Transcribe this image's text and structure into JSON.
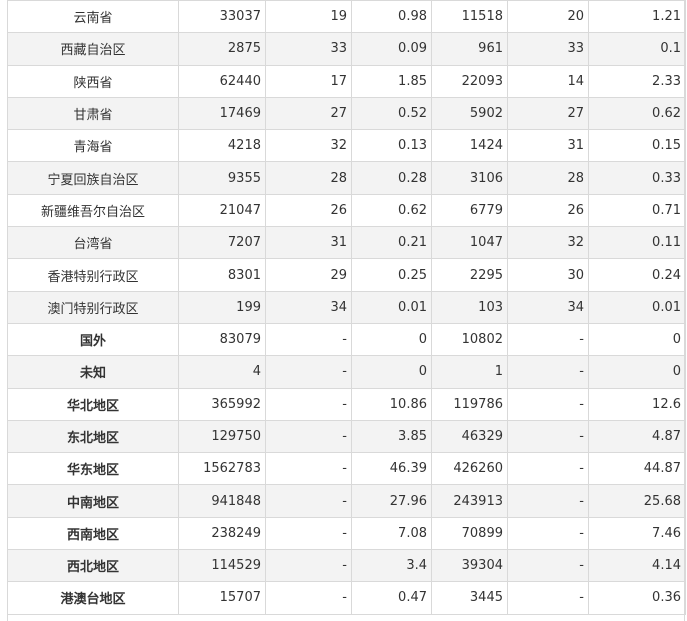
{
  "rows": [
    {
      "name": "云南省",
      "v1": "33037",
      "r1": "19",
      "p1": "0.98",
      "v2": "11518",
      "r2": "20",
      "p2": "1.21",
      "bold": false
    },
    {
      "name": "西藏自治区",
      "v1": "2875",
      "r1": "33",
      "p1": "0.09",
      "v2": "961",
      "r2": "33",
      "p2": "0.1",
      "bold": false
    },
    {
      "name": "陕西省",
      "v1": "62440",
      "r1": "17",
      "p1": "1.85",
      "v2": "22093",
      "r2": "14",
      "p2": "2.33",
      "bold": false
    },
    {
      "name": "甘肃省",
      "v1": "17469",
      "r1": "27",
      "p1": "0.52",
      "v2": "5902",
      "r2": "27",
      "p2": "0.62",
      "bold": false
    },
    {
      "name": "青海省",
      "v1": "4218",
      "r1": "32",
      "p1": "0.13",
      "v2": "1424",
      "r2": "31",
      "p2": "0.15",
      "bold": false
    },
    {
      "name": "宁夏回族自治区",
      "v1": "9355",
      "r1": "28",
      "p1": "0.28",
      "v2": "3106",
      "r2": "28",
      "p2": "0.33",
      "bold": false
    },
    {
      "name": "新疆维吾尔自治区",
      "v1": "21047",
      "r1": "26",
      "p1": "0.62",
      "v2": "6779",
      "r2": "26",
      "p2": "0.71",
      "bold": false
    },
    {
      "name": "台湾省",
      "v1": "7207",
      "r1": "31",
      "p1": "0.21",
      "v2": "1047",
      "r2": "32",
      "p2": "0.11",
      "bold": false
    },
    {
      "name": "香港特别行政区",
      "v1": "8301",
      "r1": "29",
      "p1": "0.25",
      "v2": "2295",
      "r2": "30",
      "p2": "0.24",
      "bold": false
    },
    {
      "name": "澳门特别行政区",
      "v1": "199",
      "r1": "34",
      "p1": "0.01",
      "v2": "103",
      "r2": "34",
      "p2": "0.01",
      "bold": false
    },
    {
      "name": "国外",
      "v1": "83079",
      "r1": "-",
      "p1": "0",
      "v2": "10802",
      "r2": "-",
      "p2": "0",
      "bold": true
    },
    {
      "name": "未知",
      "v1": "4",
      "r1": "-",
      "p1": "0",
      "v2": "1",
      "r2": "-",
      "p2": "0",
      "bold": true
    },
    {
      "name": "华北地区",
      "v1": "365992",
      "r1": "-",
      "p1": "10.86",
      "v2": "119786",
      "r2": "-",
      "p2": "12.6",
      "bold": true
    },
    {
      "name": "东北地区",
      "v1": "129750",
      "r1": "-",
      "p1": "3.85",
      "v2": "46329",
      "r2": "-",
      "p2": "4.87",
      "bold": true
    },
    {
      "name": "华东地区",
      "v1": "1562783",
      "r1": "-",
      "p1": "46.39",
      "v2": "426260",
      "r2": "-",
      "p2": "44.87",
      "bold": true
    },
    {
      "name": "中南地区",
      "v1": "941848",
      "r1": "-",
      "p1": "27.96",
      "v2": "243913",
      "r2": "-",
      "p2": "25.68",
      "bold": true
    },
    {
      "name": "西南地区",
      "v1": "238249",
      "r1": "-",
      "p1": "7.08",
      "v2": "70899",
      "r2": "-",
      "p2": "7.46",
      "bold": true
    },
    {
      "name": "西北地区",
      "v1": "114529",
      "r1": "-",
      "p1": "3.4",
      "v2": "39304",
      "r2": "-",
      "p2": "4.14",
      "bold": true
    },
    {
      "name": "港澳台地区",
      "v1": "15707",
      "r1": "-",
      "p1": "0.47",
      "v2": "3445",
      "r2": "-",
      "p2": "0.36",
      "bold": true
    }
  ]
}
